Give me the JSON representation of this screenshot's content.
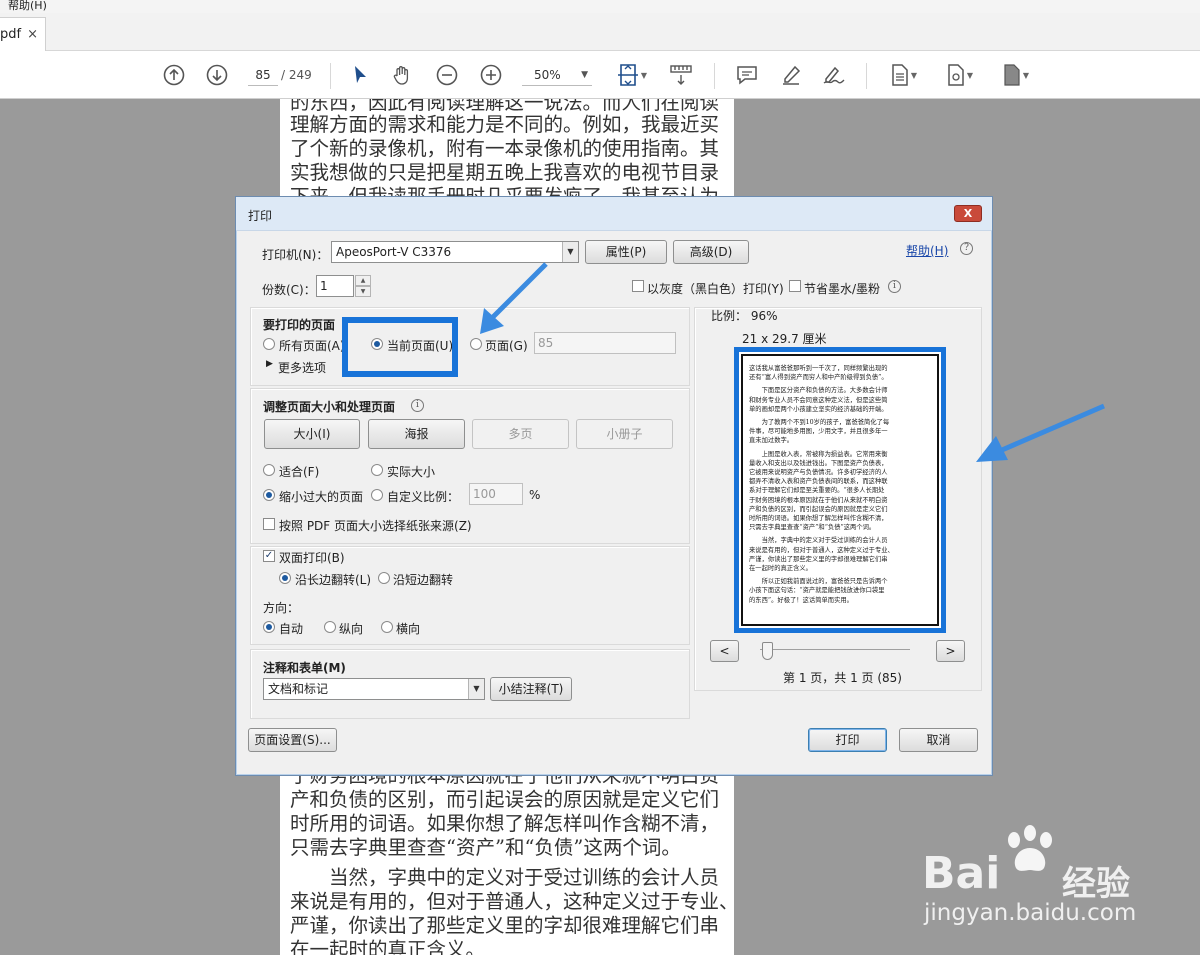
{
  "menubar": {
    "help": "帮助(H)"
  },
  "tab": {
    "label": "pdf",
    "close": "×"
  },
  "toolbar": {
    "page_current": "85",
    "page_total": "/ 249",
    "zoom": "50%",
    "icons": [
      "up-arrow-icon",
      "down-arrow-icon",
      "cursor-icon",
      "hand-icon",
      "zoom-out-icon",
      "zoom-in-icon",
      "fit-page-icon",
      "scroll-mode-icon",
      "comment-icon",
      "highlight-icon",
      "sign-icon",
      "page-tool-icon",
      "page-settings-icon",
      "document-icon"
    ]
  },
  "document": {
    "lines_top": [
      "的东西，因此有阅读理解这一说法。而人们在阅读",
      "理解方面的需求和能力是不同的。例如，我最近买",
      "了个新的录像机，附有一本录像机的使用指南。其",
      "实我想做的只是把星期五晚上我喜欢的电视节目录",
      "下来，但我读那手册时几乎要发疯了。我甚至认为"
    ],
    "lines_bottom": [
      "于财务困境的根本原因就在于他们从来就不明白资",
      "产和负债的区别，而引起误会的原因就是定义它们",
      "时所用的词语。如果你想了解怎样叫作含糊不清，",
      "只需去字典里查查“资产”和“负债”这两个词。",
      "　　当然，字典中的定义对于受过训练的会计人员",
      "来说是有用的，但对于普通人，这种定义过于专业、",
      "严谨，你读出了那些定义里的字却很难理解它们串",
      "在一起时的真正含义。"
    ]
  },
  "dialog": {
    "title": "打印",
    "close": "X",
    "printer_label": "打印机(N)：",
    "printer_value": "ApeosPort-V C3376",
    "properties_button": "属性(P)",
    "advanced_button": "高级(D)",
    "help_link": "帮助(H)",
    "copies_label": "份数(C)：",
    "copies_value": "1",
    "grayscale_label": "以灰度（黑白色）打印(Y)",
    "save_ink_label": "节省墨水/墨粉",
    "pages_section": {
      "title": "要打印的页面",
      "all_pages": "所有页面(A)",
      "current_page": "当前页面(U)",
      "pages": "页面(G)",
      "pages_value": "85",
      "more_options": "更多选项"
    },
    "sizing_section": {
      "title": "调整页面大小和处理页面",
      "size_button": "大小(I)",
      "poster_button": "海报",
      "multiple_button": "多页",
      "booklet_button": "小册子",
      "fit": "适合(F)",
      "actual_size": "实际大小",
      "shrink": "缩小过大的页面",
      "custom_scale": "自定义比例：",
      "custom_scale_value": "100",
      "percent": "%",
      "choose_paper": "按照 PDF 页面大小选择纸张来源(Z)"
    },
    "duplex_section": {
      "duplex": "双面打印(B)",
      "long_edge": "沿长边翻转(L)",
      "short_edge": "沿短边翻转",
      "orientation_label": "方向：",
      "auto": "自动",
      "portrait": "纵向",
      "landscape": "横向"
    },
    "comments_section": {
      "title": "注释和表单(M)",
      "value": "文档和标记",
      "summarize_button": "小结注释(T)"
    },
    "preview": {
      "scale": "比例： 96%",
      "size": "21 x 29.7 厘米",
      "prev": "<",
      "next": ">",
      "page_info": "第 1 页，共 1 页 (85)",
      "lines": [
        "这话我从富爸爸那听到一千次了，同样频繁出现的",
        "还有“富人得到资产而穷人和中产阶级得到负债”。",
        "",
        "　　下面是区分资产和负债的方法。大多数会计师",
        "和财务专业人员不会同意这种定义法，但是这些简",
        "单的画却是两个小孩建立坚实的经济基础的开端。",
        "",
        "　　为了教两个不到10岁的孩子，富爸爸简化了每",
        "件事，尽可能地多用图，少用文字，并且很多年一",
        "直未加过数字。",
        "",
        "　　上图是收入表，常被称为损益表。它常用来衡",
        "量收入和支出以及钱进钱出。下图是资产负债表，",
        "它被用来说明资产与负债情况。许多初学经济的人",
        "都弄不清收入表和资产负债表间的联系，而这种联",
        "系对于理解它们却是至关重要的。“很多人长期处",
        "于财务困境的根本原因就在于他们从来就不明白资",
        "产和负债的区别，而引起误会的原因就是定义它们",
        "时所用的词语。如果你想了解怎样叫作含糊不清，",
        "只需去字典里查查“资产”和“负债”这两个词。",
        "",
        "　　当然，字典中的定义对于受过训练的会计人员",
        "来说是有用的，但对于普通人，这种定义过于专业、",
        "严谨，你读出了那些定义里的字却很难理解它们串",
        "在一起时的真正含义。",
        "",
        "　　所以正如我前面说过的，富爸爸只是告诉两个",
        "小孩下面这句话：“资产就是能把钱放进你口袋里",
        "的东西”。好极了！这话简单而实用。"
      ]
    },
    "page_setup_button": "页面设置(S)...",
    "print_button": "打印",
    "cancel_button": "取消"
  },
  "watermark": {
    "brand": "Bai",
    "brand2": "经验",
    "url": "jingyan.baidu.com"
  },
  "colors": {
    "highlight": "#1873d8",
    "arrow": "#3b8be0",
    "background": "#9a9a9a"
  }
}
